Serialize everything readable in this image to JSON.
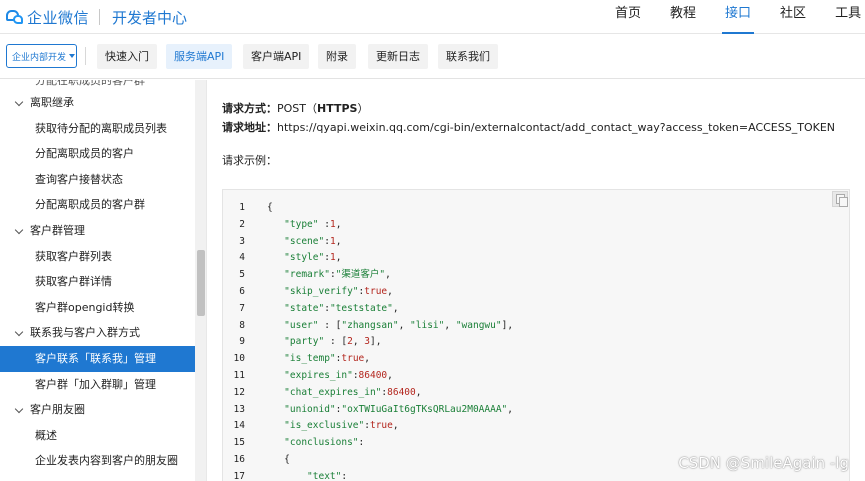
{
  "header": {
    "brand": "企业微信",
    "subtitle": "开发者中心",
    "nav": [
      "首页",
      "教程",
      "接口",
      "社区",
      "工具"
    ],
    "nav_active": 2
  },
  "subnav": {
    "scope": "企业内部开发",
    "tabs": [
      "快速入门",
      "服务端API",
      "客户端API",
      "附录",
      "更新日志",
      "联系我们"
    ],
    "active_tab": 1
  },
  "sidebar": {
    "cut_item": "分配在职成员的客户群",
    "items": [
      {
        "label": "离职继承",
        "type": "group"
      },
      {
        "label": "获取待分配的离职成员列表",
        "type": "child"
      },
      {
        "label": "分配离职成员的客户",
        "type": "child"
      },
      {
        "label": "查询客户接替状态",
        "type": "child"
      },
      {
        "label": "分配离职成员的客户群",
        "type": "child"
      },
      {
        "label": "客户群管理",
        "type": "group"
      },
      {
        "label": "获取客户群列表",
        "type": "child"
      },
      {
        "label": "获取客户群详情",
        "type": "child"
      },
      {
        "label": "客户群opengid转换",
        "type": "child"
      },
      {
        "label": "联系我与客户入群方式",
        "type": "group"
      },
      {
        "label": "客户联系「联系我」管理",
        "type": "child",
        "active": true
      },
      {
        "label": "客户群「加入群聊」管理",
        "type": "child"
      },
      {
        "label": "客户朋友圈",
        "type": "group"
      },
      {
        "label": "概述",
        "type": "child"
      },
      {
        "label": "企业发表内容到客户的朋友圈",
        "type": "child"
      }
    ]
  },
  "main": {
    "method_label": "请求方式：",
    "method_value": "POST（",
    "method_proto": "HTTPS",
    "method_close": "）",
    "url_label": "请求地址：",
    "url_value": "https://qyapi.weixin.qq.com/cgi-bin/externalcontact/add_contact_way?access_token=ACCESS_TOKEN",
    "example_label": "请求示例：",
    "code_lines": [
      {
        "n": "1",
        "c": "{"
      },
      {
        "n": "2",
        "c": "   \"type\" :1,"
      },
      {
        "n": "3",
        "c": "   \"scene\":1,"
      },
      {
        "n": "4",
        "c": "   \"style\":1,"
      },
      {
        "n": "5",
        "c": "   \"remark\":\"渠道客户\","
      },
      {
        "n": "6",
        "c": "   \"skip_verify\":true,"
      },
      {
        "n": "7",
        "c": "   \"state\":\"teststate\","
      },
      {
        "n": "8",
        "c": "   \"user\" : [\"zhangsan\", \"lisi\", \"wangwu\"],"
      },
      {
        "n": "9",
        "c": "   \"party\" : [2, 3],"
      },
      {
        "n": "10",
        "c": "   \"is_temp\":true,"
      },
      {
        "n": "11",
        "c": "   \"expires_in\":86400,"
      },
      {
        "n": "12",
        "c": "   \"chat_expires_in\":86400,"
      },
      {
        "n": "13",
        "c": "   \"unionid\":\"oxTWIuGaIt6gTKsQRLau2M0AAAA\","
      },
      {
        "n": "14",
        "c": "   \"is_exclusive\":true,"
      },
      {
        "n": "15",
        "c": "   \"conclusions\":"
      },
      {
        "n": "16",
        "c": "   {"
      },
      {
        "n": "17",
        "c": "       \"text\":"
      }
    ]
  },
  "watermark": "CSDN @SmileAgain -lg",
  "colors": {
    "accent": "#1f78d1",
    "string": "#1a7f37",
    "number": "#b3261e"
  }
}
